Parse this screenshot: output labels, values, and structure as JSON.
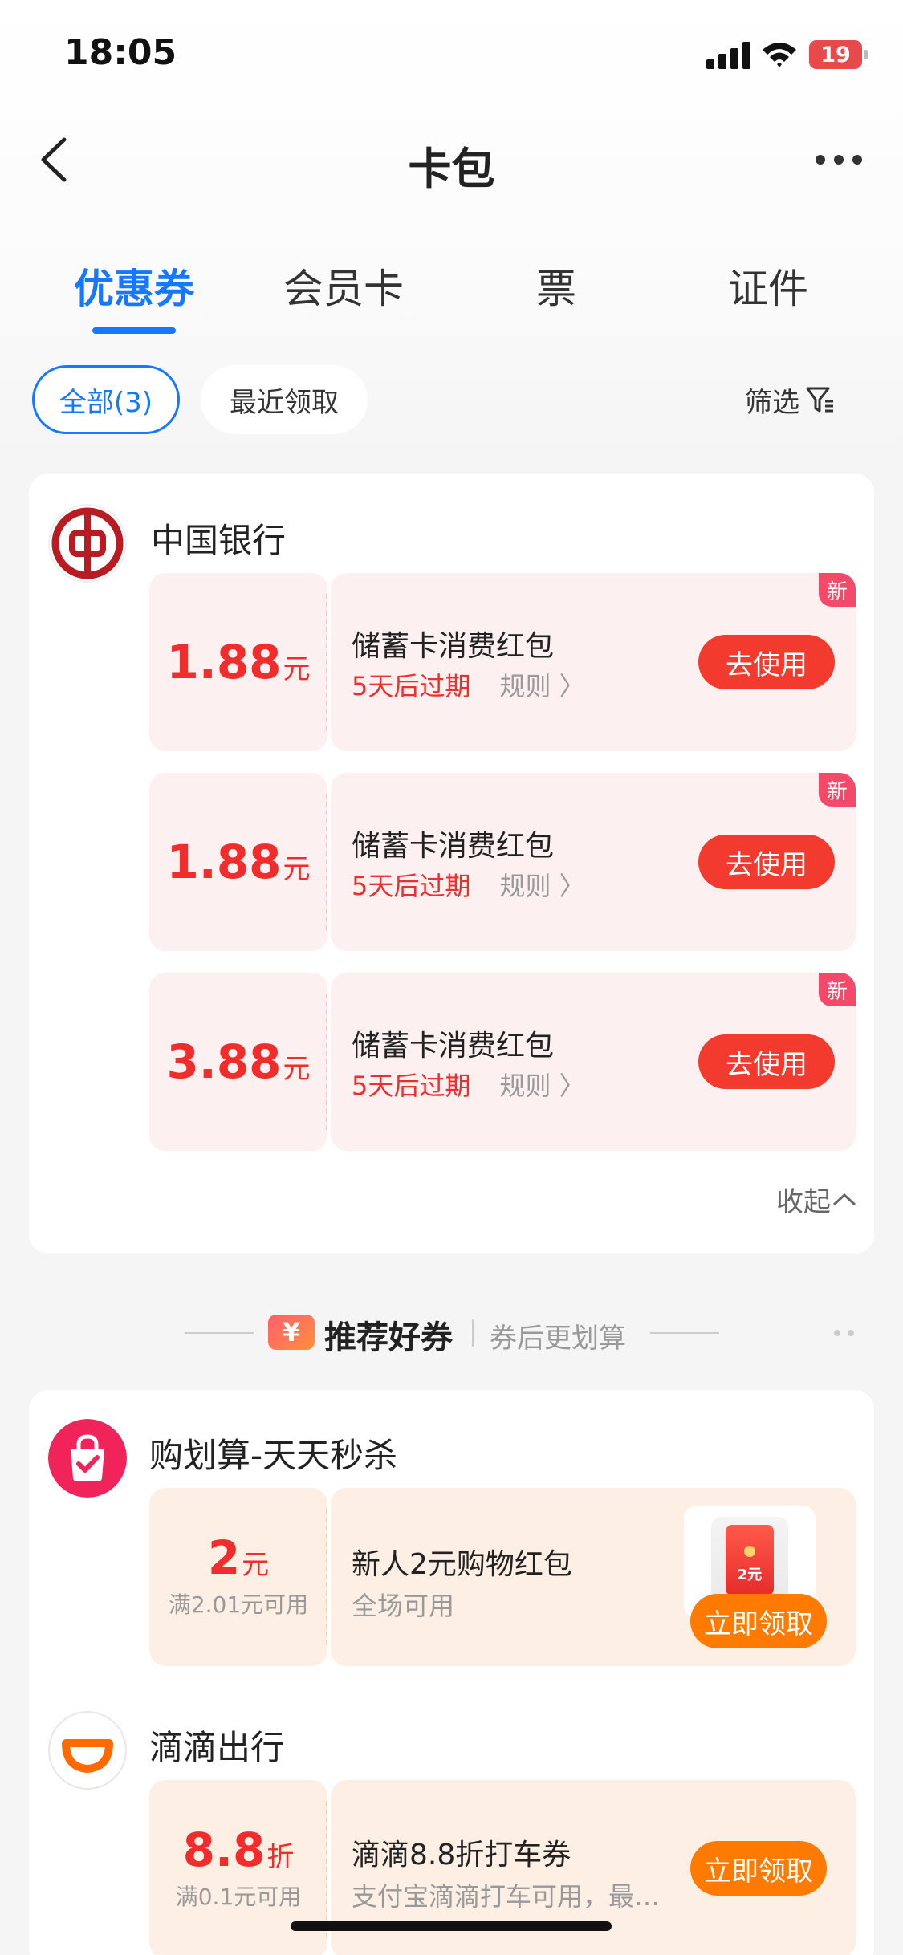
{
  "status_bar": {
    "time": "18:05",
    "battery": "19"
  },
  "nav": {
    "title": "卡包"
  },
  "tabs": [
    {
      "label": "优惠券",
      "active": true
    },
    {
      "label": "会员卡"
    },
    {
      "label": "票"
    },
    {
      "label": "证件"
    }
  ],
  "filters": {
    "all": "全部(3)",
    "recent": "最近领取",
    "filter": "筛选"
  },
  "bank": {
    "name": "中国银行",
    "coupons": [
      {
        "amount": "1.88",
        "unit": "元",
        "title": "储蓄卡消费红包",
        "expiry": "5天后过期",
        "rule": "规则",
        "button": "去使用",
        "badge": "新"
      },
      {
        "amount": "1.88",
        "unit": "元",
        "title": "储蓄卡消费红包",
        "expiry": "5天后过期",
        "rule": "规则",
        "button": "去使用",
        "badge": "新"
      },
      {
        "amount": "3.88",
        "unit": "元",
        "title": "储蓄卡消费红包",
        "expiry": "5天后过期",
        "rule": "规则",
        "button": "去使用",
        "badge": "新"
      }
    ],
    "collapse": "收起"
  },
  "recommend": {
    "icon": "¥",
    "title": "推荐好券",
    "subtitle": "券后更划算",
    "items": [
      {
        "brand": "购划算-天天秒杀",
        "amount": "2",
        "unit": "元",
        "condition": "满2.01元可用",
        "title": "新人2元购物红包",
        "sub": "全场可用",
        "button": "立即领取",
        "gift_label": "2元"
      },
      {
        "brand": "滴滴出行",
        "amount": "8.8",
        "unit": "折",
        "condition": "满0.1元可用",
        "title": "滴滴8.8折打车券",
        "sub": "支付宝滴滴打车可用，最…",
        "button": "立即领取"
      }
    ]
  },
  "colors": {
    "accent": "#1677ff",
    "red": "#f02d2d",
    "orange": "#ff7a00"
  }
}
